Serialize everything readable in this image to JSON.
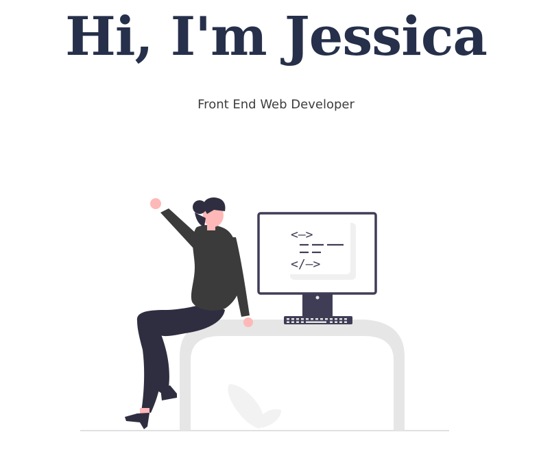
{
  "hero": {
    "title": "Hi, I'm Jessica",
    "subtitle": "Front End Web Developer"
  },
  "illustration": {
    "screen_code_lines": [
      "<—>",
      "</—>"
    ]
  },
  "colors": {
    "title": "#26304a",
    "subtitle": "#3d3d3d",
    "desk": "#e6e6e6",
    "monitor": "#3f3d56",
    "shirt": "#3b3b3b",
    "pants": "#2f2e41",
    "skin": "#ffb8b8"
  }
}
